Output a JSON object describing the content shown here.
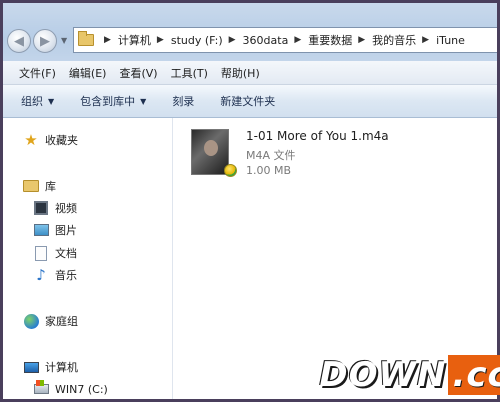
{
  "address": {
    "crumbs": [
      "计算机",
      "study (F:)",
      "360data",
      "重要数据",
      "我的音乐",
      "iTune"
    ]
  },
  "menu": {
    "items": [
      "文件(F)",
      "编辑(E)",
      "查看(V)",
      "工具(T)",
      "帮助(H)"
    ]
  },
  "commands": {
    "organize": "组织",
    "include_in_library": "包含到库中",
    "burn": "刻录",
    "new_folder": "新建文件夹"
  },
  "sidebar": {
    "favorites": "收藏夹",
    "libraries": "库",
    "videos": "视频",
    "pictures": "图片",
    "documents": "文档",
    "music": "音乐",
    "homegroup": "家庭组",
    "computer": "计算机",
    "drive_c": "WIN7 (C:)"
  },
  "file": {
    "name": "1-01 More of You 1.m4a",
    "type": "M4A 文件",
    "size": "1.00 MB",
    "icon": "album-art-thumbnail"
  },
  "watermark": {
    "main": "DOWN",
    "tld": ".cc"
  }
}
